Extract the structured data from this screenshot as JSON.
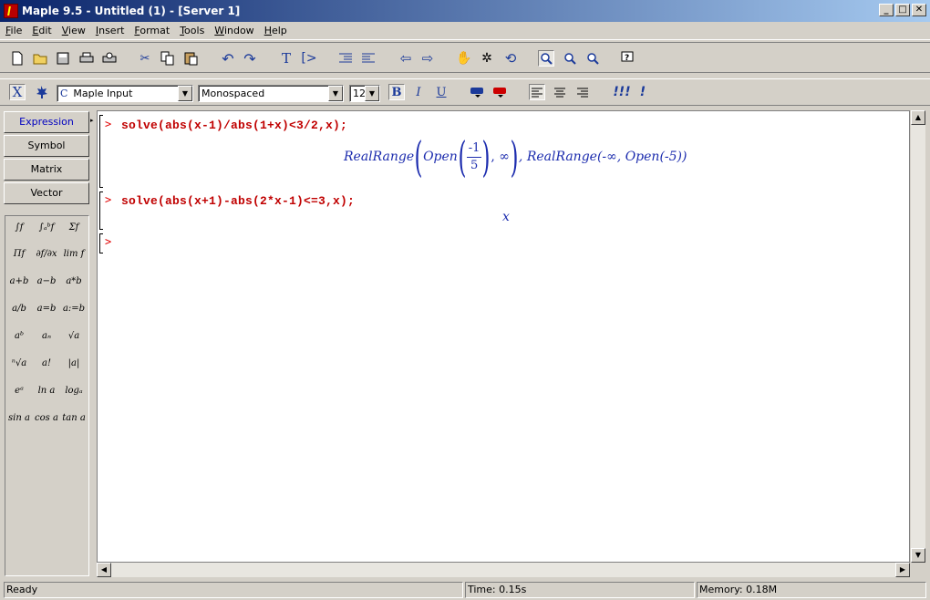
{
  "window": {
    "title": "Maple 9.5 - Untitled (1) - [Server 1]",
    "controls": [
      "_",
      "□",
      "✕"
    ]
  },
  "menu": [
    "File",
    "Edit",
    "View",
    "Insert",
    "Format",
    "Tools",
    "Window",
    "Help"
  ],
  "toolbar2": {
    "mode_x": "X",
    "style_prefix": "C",
    "style_value": "Maple Input",
    "font_value": "Monospaced",
    "size_value": "12",
    "bold": "B",
    "italic": "I",
    "underline": "U",
    "exec_all": "!!!",
    "exec": "!"
  },
  "palette": {
    "buttons": [
      "Expression",
      "Symbol",
      "Matrix",
      "Vector"
    ],
    "symbols": [
      [
        "∫f",
        "∫ₐᵇf",
        "Σf"
      ],
      [
        "Πf",
        "∂f/∂x",
        "lim f"
      ],
      [
        "a+b",
        "a−b",
        "a*b"
      ],
      [
        "a/b",
        "a=b",
        "a:=b"
      ],
      [
        "aᵇ",
        "aₙ",
        "√a"
      ],
      [
        "ⁿ√a",
        "a!",
        "|a|"
      ],
      [
        "eᵃ",
        "ln a",
        "logₐ"
      ],
      [
        "sin a",
        "cos a",
        "tan a"
      ]
    ]
  },
  "worksheet": {
    "prompt": ">",
    "inputs": [
      "solve(abs(x-1)/abs(1+x)<3/2,x);",
      "solve(abs(x+1)-abs(2*x-1)<=3,x);"
    ],
    "output1": {
      "rr": "RealRange",
      "open": "Open",
      "num": "-1",
      "den": "5",
      "inf": ", ∞",
      "rest": ", RealRange(-∞, Open(-5))"
    },
    "output2": "x"
  },
  "status": {
    "state": "Ready",
    "time": "Time: 0.15s",
    "memory": "Memory: 0.18M"
  }
}
